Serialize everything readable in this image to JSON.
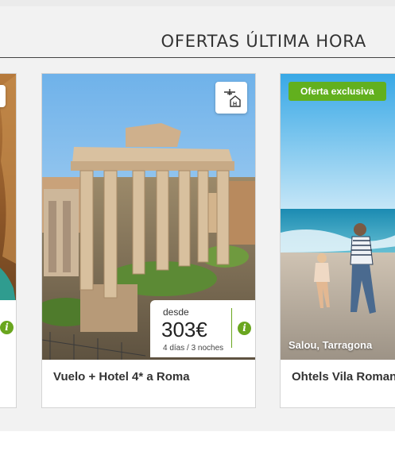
{
  "section": {
    "title": "OFERTAS ÚLTIMA HORA"
  },
  "cards": [
    {
      "position": "left-partial",
      "caption": ""
    },
    {
      "position": "main",
      "caption": "Vuelo + Hotel 4* a Roma",
      "type_icon": "flight-hotel-icon",
      "price": {
        "prefix": "desde",
        "value": "303€",
        "details": "4 días / 3 noches"
      }
    },
    {
      "position": "right-partial",
      "caption": "Ohtels Vila Romana",
      "badge": "Oferta exclusiva",
      "location": "Salou, Tarragona"
    }
  ],
  "colors": {
    "accent": "#62b01e",
    "text": "#333333"
  }
}
